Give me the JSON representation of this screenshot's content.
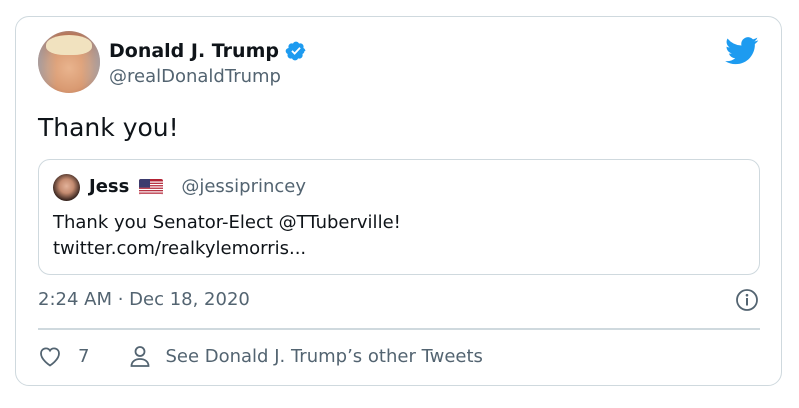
{
  "tweet": {
    "author_name": "Donald J. Trump",
    "author_handle": "@realDonaldTrump",
    "text": "Thank you!",
    "timestamp": "2:24 AM · Dec 18, 2020",
    "like_count": "7",
    "other_tweets_label": "See Donald J. Trump’s other Tweets"
  },
  "quoted_tweet": {
    "author_name": "Jess",
    "author_handle": "@jessiprincey",
    "text_line1": "Thank you Senator-Elect @TTuberville!",
    "text_line2": "twitter.com/realkylemorris..."
  },
  "icons": {
    "verified": "verified-badge-icon",
    "brand": "twitter-bird-icon",
    "flag": "us-flag-icon",
    "info": "info-icon",
    "like": "heart-icon",
    "profile": "person-icon"
  },
  "colors": {
    "brand_blue": "#1d9bf0",
    "text_primary": "#0f1419",
    "text_secondary": "#536471",
    "border": "#cfd9de"
  }
}
